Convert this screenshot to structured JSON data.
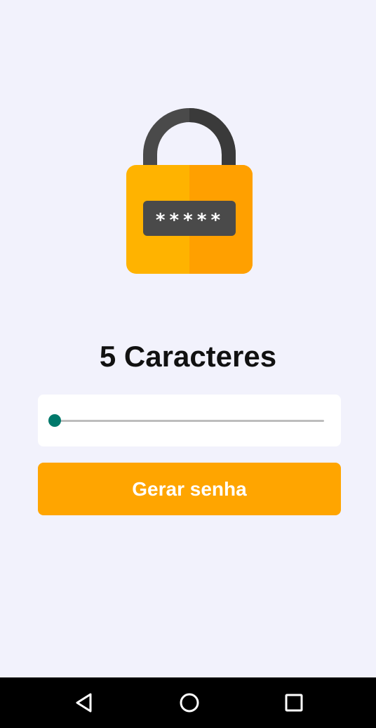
{
  "lock": {
    "icon": "padlock-password-icon",
    "mask_text": "*****",
    "colors": {
      "body_light": "#FFB300",
      "body_dark": "#FFA000",
      "shackle_light": "#5A5A5A",
      "shackle_dark": "#3E3E3E",
      "field": "#4A4A4A"
    }
  },
  "length": {
    "value": 5,
    "label": "5 Caracteres"
  },
  "slider": {
    "min": 5,
    "max": 20,
    "value": 5,
    "colors": {
      "active": "#00796B",
      "track": "#BDBDBD"
    }
  },
  "generate_button": {
    "label": "Gerar senha",
    "color": "#FFA500"
  },
  "nav": {
    "back_icon": "triangle-back-icon",
    "home_icon": "circle-home-icon",
    "recent_icon": "square-recents-icon"
  }
}
